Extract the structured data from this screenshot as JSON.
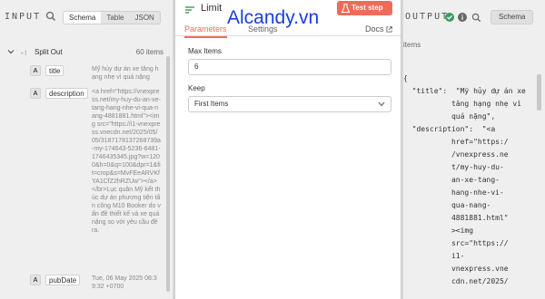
{
  "left": {
    "title": "INPUT",
    "tabs": [
      "Schema",
      "Table",
      "JSON"
    ],
    "tree": {
      "label": "Split Out",
      "count": "60 items"
    },
    "fields": [
      {
        "type": "A",
        "name": "title",
        "value": "Mỹ hủy dự án xe tăng hạng nhẹ vì quá nặng"
      },
      {
        "type": "A",
        "name": "description",
        "value": "<a href=\"https://vnexpress.net/my-huy-du-an-xe-tang-hang-nhe-vi-qua-nang-4881881.html\"><img src=\"https://i1-vnexpress.vnecdn.net/2025/05/05/3187178137268739a-my-174643-5236-6481-1746435345.jpg?w=1200&h=0&q=100&dpr=1&fit=crop&s=MvFEeARVKfYA1CfZ2hRZUw\"></a></br>Lục quân Mỹ kết thúc dự án phương tiện tấn công M10 Booker do vấn đề thiết kế và xe quá nặng so với yêu cầu đề ra."
      },
      {
        "type": "A",
        "name": "pubDate",
        "value": "Tue, 06 May 2025 08:39:32 +0700"
      }
    ]
  },
  "center": {
    "title": "Limit",
    "test_button": "Test step",
    "watermark": "Alcandy.vn",
    "tabs": [
      "Parameters",
      "Settings"
    ],
    "docs": "Docs",
    "max_items_label": "Max Items",
    "max_items_value": "6",
    "keep_label": "Keep",
    "keep_value": "First Items"
  },
  "right": {
    "title": "OUTPUT",
    "tab": "Schema",
    "items_label": "items",
    "json_lines": [
      "{",
      "  \"title\":  \"Mỹ hủy dự án xe",
      "           tăng hạng nhẹ vì",
      "           quá nặng\",",
      "  \"description\":  \"<a",
      "           href=\"https:/",
      "           /vnexpress.ne",
      "           t/my-huy-du-",
      "           an-xe-tang-",
      "           hang-nhe-vi-",
      "           qua-nang-",
      "           4881881.html\"",
      "           ><img",
      "           src=\"https://",
      "           i1-",
      "           vnexpress.vne",
      "           cdn.net/2025/"
    ]
  },
  "colors": {
    "accent": "#ee6b5a",
    "watermark": "#1a3edc",
    "success": "#3a9b5c"
  }
}
